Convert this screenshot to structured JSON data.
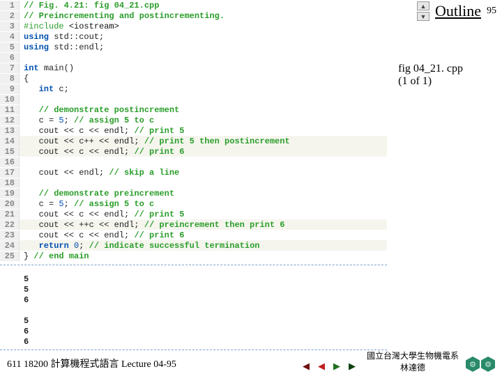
{
  "slide_number": "95",
  "outline_label": "Outline",
  "file_label": "fig 04_21. cpp\n(1 of 1)",
  "footer_left": "611 18200 計算機程式語言  Lecture 04-95",
  "footer_right_l1": "國立台灣大學生物機電系",
  "footer_right_l2": "林達德",
  "code": [
    {
      "n": "1",
      "seg": [
        {
          "c": "c-comment",
          "t": "// Fig. 4.21: fig 04_21.cpp"
        }
      ]
    },
    {
      "n": "2",
      "seg": [
        {
          "c": "c-comment",
          "t": "// Preincrementing and postincrementing."
        }
      ]
    },
    {
      "n": "3",
      "seg": [
        {
          "c": "c-pre",
          "t": "#include "
        },
        {
          "c": "c-angle",
          "t": "<iostream>"
        }
      ]
    },
    {
      "n": "4",
      "seg": [
        {
          "c": "c-kw",
          "t": "using "
        },
        {
          "c": "c-plain",
          "t": "std::cout;"
        }
      ]
    },
    {
      "n": "5",
      "seg": [
        {
          "c": "c-kw",
          "t": "using "
        },
        {
          "c": "c-plain",
          "t": "std::endl;"
        }
      ]
    },
    {
      "n": "6",
      "seg": []
    },
    {
      "n": "7",
      "seg": [
        {
          "c": "c-kw",
          "t": "int "
        },
        {
          "c": "c-plain",
          "t": "main()"
        }
      ]
    },
    {
      "n": "8",
      "seg": [
        {
          "c": "c-plain",
          "t": "{"
        }
      ]
    },
    {
      "n": "9",
      "seg": [
        {
          "c": "c-plain",
          "t": "   "
        },
        {
          "c": "c-kw",
          "t": "int "
        },
        {
          "c": "c-plain",
          "t": "c;"
        }
      ]
    },
    {
      "n": "10",
      "seg": []
    },
    {
      "n": "11",
      "seg": [
        {
          "c": "c-plain",
          "t": "   "
        },
        {
          "c": "c-comment",
          "t": "// demonstrate postincrement"
        }
      ]
    },
    {
      "n": "12",
      "seg": [
        {
          "c": "c-plain",
          "t": "   c = "
        },
        {
          "c": "c-num",
          "t": "5"
        },
        {
          "c": "c-plain",
          "t": "; "
        },
        {
          "c": "c-comment",
          "t": "// assign 5 to c"
        }
      ]
    },
    {
      "n": "13",
      "seg": [
        {
          "c": "c-plain",
          "t": "   cout << c << endl; "
        },
        {
          "c": "c-comment",
          "t": "// print 5"
        }
      ]
    },
    {
      "n": "14",
      "hl": true,
      "seg": [
        {
          "c": "c-plain",
          "t": "   cout << c++ << endl; "
        },
        {
          "c": "c-comment",
          "t": "// print 5 then postincrement"
        }
      ]
    },
    {
      "n": "15",
      "hl": true,
      "seg": [
        {
          "c": "c-plain",
          "t": "   cout << c << endl; "
        },
        {
          "c": "c-comment",
          "t": "// print 6"
        }
      ]
    },
    {
      "n": "16",
      "seg": []
    },
    {
      "n": "17",
      "seg": [
        {
          "c": "c-plain",
          "t": "   cout << endl; "
        },
        {
          "c": "c-comment",
          "t": "// skip a line"
        }
      ]
    },
    {
      "n": "18",
      "seg": []
    },
    {
      "n": "19",
      "seg": [
        {
          "c": "c-plain",
          "t": "   "
        },
        {
          "c": "c-comment",
          "t": "// demonstrate preincrement"
        }
      ]
    },
    {
      "n": "20",
      "seg": [
        {
          "c": "c-plain",
          "t": "   c = "
        },
        {
          "c": "c-num",
          "t": "5"
        },
        {
          "c": "c-plain",
          "t": "; "
        },
        {
          "c": "c-comment",
          "t": "// assign 5 to c"
        }
      ]
    },
    {
      "n": "21",
      "seg": [
        {
          "c": "c-plain",
          "t": "   cout << c << endl; "
        },
        {
          "c": "c-comment",
          "t": "// print 5"
        }
      ]
    },
    {
      "n": "22",
      "hl": true,
      "seg": [
        {
          "c": "c-plain",
          "t": "   cout << ++c << endl; "
        },
        {
          "c": "c-comment",
          "t": "// preincrement then print 6"
        }
      ]
    },
    {
      "n": "23",
      "seg": [
        {
          "c": "c-plain",
          "t": "   cout << c << endl; "
        },
        {
          "c": "c-comment",
          "t": "// print 6"
        }
      ]
    },
    {
      "n": "24",
      "hl": true,
      "seg": [
        {
          "c": "c-plain",
          "t": "   "
        },
        {
          "c": "c-kw",
          "t": "return "
        },
        {
          "c": "c-num",
          "t": "0"
        },
        {
          "c": "c-plain",
          "t": "; "
        },
        {
          "c": "c-comment",
          "t": "// indicate successful termination"
        }
      ]
    },
    {
      "n": "25",
      "seg": [
        {
          "c": "c-plain",
          "t": "} "
        },
        {
          "c": "c-comment",
          "t": "// end main"
        }
      ]
    }
  ],
  "output": [
    "5",
    "5",
    "6",
    "",
    "5",
    "6",
    "6"
  ]
}
